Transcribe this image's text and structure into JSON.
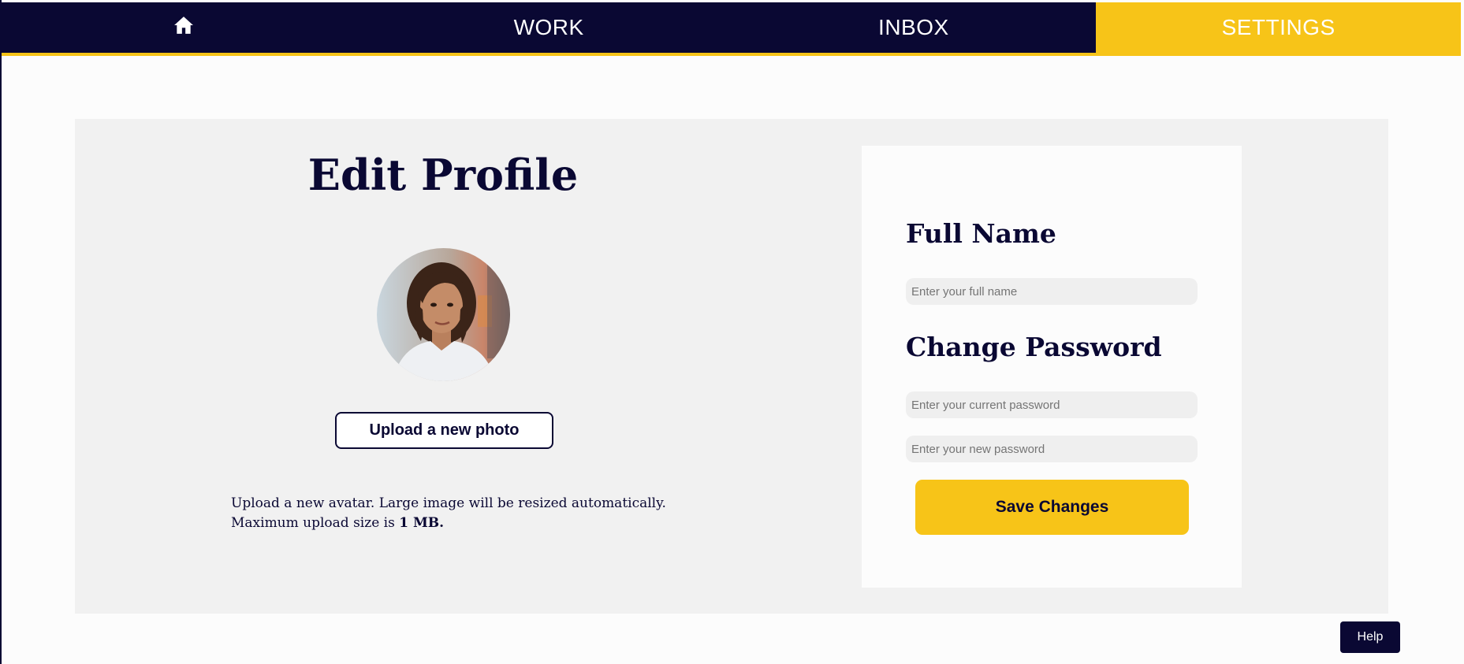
{
  "nav": {
    "home_icon": "home-icon",
    "items": [
      {
        "label": "WORK"
      },
      {
        "label": "INBOX"
      },
      {
        "label": "SETTINGS"
      }
    ],
    "active": "SETTINGS"
  },
  "profile": {
    "title": "Edit Profile",
    "upload_label": "Upload a new photo",
    "hint_text": "Upload a new avatar. Large image will be resized automatically.",
    "hint_size_prefix": "Maximum upload size is ",
    "hint_size_value": "1 MB."
  },
  "form": {
    "full_name_heading": "Full Name",
    "full_name_placeholder": "Enter your full name",
    "full_name_value": "",
    "password_heading": "Change Password",
    "current_password_placeholder": "Enter your current password",
    "new_password_placeholder": "Enter your new password",
    "save_label": "Save Changes"
  },
  "help_label": "Help",
  "colors": {
    "navy": "#0a0833",
    "accent_yellow": "#f7c418",
    "panel_gray": "#f1f1f1",
    "input_gray": "#efefef"
  }
}
